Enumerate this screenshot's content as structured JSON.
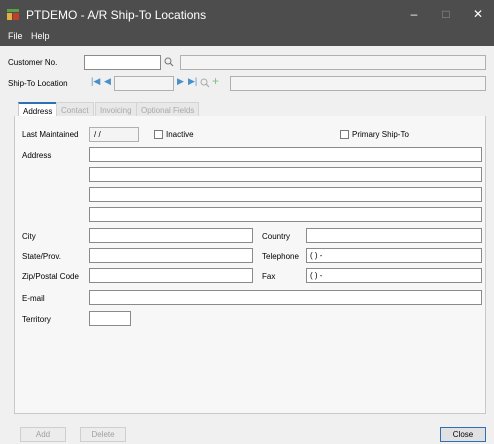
{
  "window": {
    "title": "PTDEMO - A/R Ship-To Locations",
    "minimize": "–",
    "maximize": "□",
    "close": "✕"
  },
  "menu": {
    "file": "File",
    "help": "Help"
  },
  "header": {
    "customer_label": "Customer No.",
    "customer_value": "",
    "customer_name": "",
    "shipto_label": "Ship-To Location",
    "shipto_value": "",
    "shipto_desc": "",
    "nav_first": "|◀",
    "nav_prev": "◀",
    "nav_next": "▶",
    "nav_last": "▶|",
    "add_icon": "+"
  },
  "tabs": [
    {
      "label": "Address",
      "active": true
    },
    {
      "label": "Contact",
      "active": false
    },
    {
      "label": "Invoicing",
      "active": false
    },
    {
      "label": "Optional Fields",
      "active": false
    }
  ],
  "address": {
    "last_maintained_label": "Last Maintained",
    "last_maintained_value": " /  /",
    "inactive_label": "Inactive",
    "primary_label": "Primary Ship-To",
    "address_label": "Address",
    "city_label": "City",
    "country_label": "Country",
    "state_label": "State/Prov.",
    "telephone_label": "Telephone",
    "telephone_value": "(   )    -",
    "zip_label": "Zip/Postal Code",
    "fax_label": "Fax",
    "fax_value": "(   )    -",
    "email_label": "E-mail",
    "territory_label": "Territory"
  },
  "buttons": {
    "add": "Add",
    "delete": "Delete",
    "close": "Close"
  }
}
